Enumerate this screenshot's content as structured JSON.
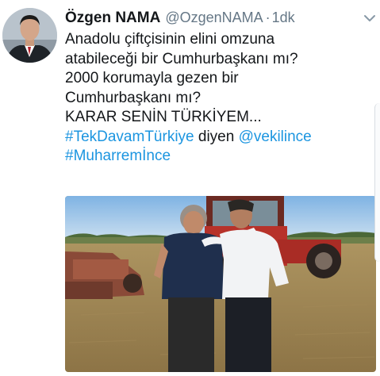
{
  "tweet": {
    "author_name": "Özgen NAMA",
    "handle": "@OzgenNAMA",
    "separator": "·",
    "time": "1dk",
    "lines": {
      "l1": "Anadolu çiftçisinin elini omzuna",
      "l2": "atabileceği bir Cumhurbaşkanı mı?",
      "l3": "2000 korumayla gezen bir",
      "l4": "Cumhurbaşkanı mı?",
      "l5": "KARAR SENİN TÜRKİYEM..."
    },
    "hashtag1": "#TekDavamTürkiye",
    "mid_text": "diyen",
    "mention": "@vekilince",
    "hashtag2": "#Muharremİnce"
  },
  "icons": {
    "more": "chevron-down-icon"
  },
  "colors": {
    "link": "#1b95e0",
    "secondary": "#657786",
    "text": "#14171a"
  }
}
